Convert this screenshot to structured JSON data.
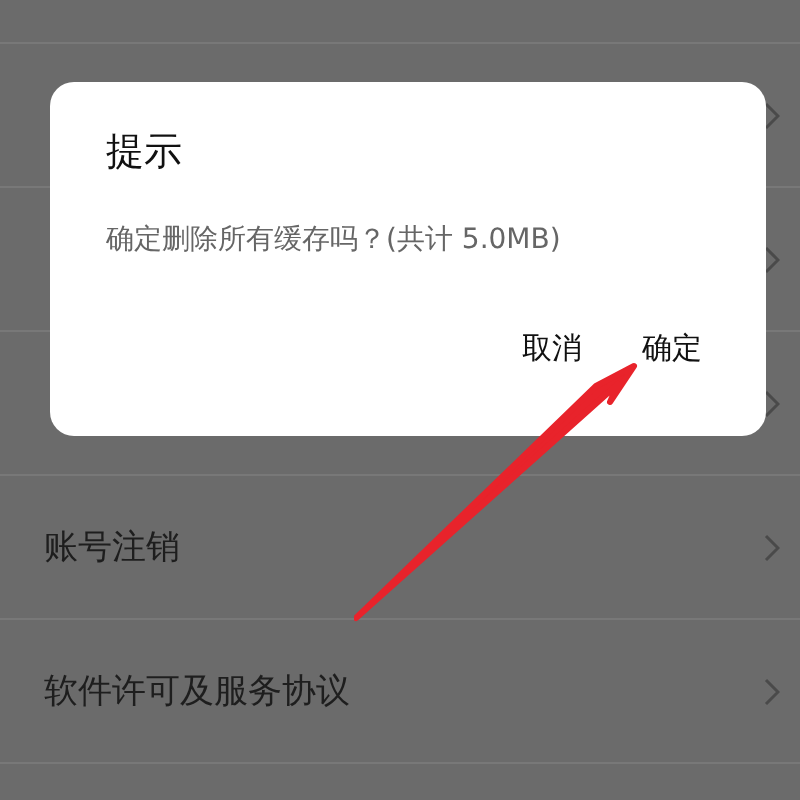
{
  "settings_list": [
    {
      "label": "账号注销"
    },
    {
      "label": "软件许可及服务协议"
    }
  ],
  "dialog": {
    "title": "提示",
    "message": "确定删除所有缓存吗？(共计 5.0MB)",
    "buttons": [
      "取消",
      "确定"
    ]
  }
}
